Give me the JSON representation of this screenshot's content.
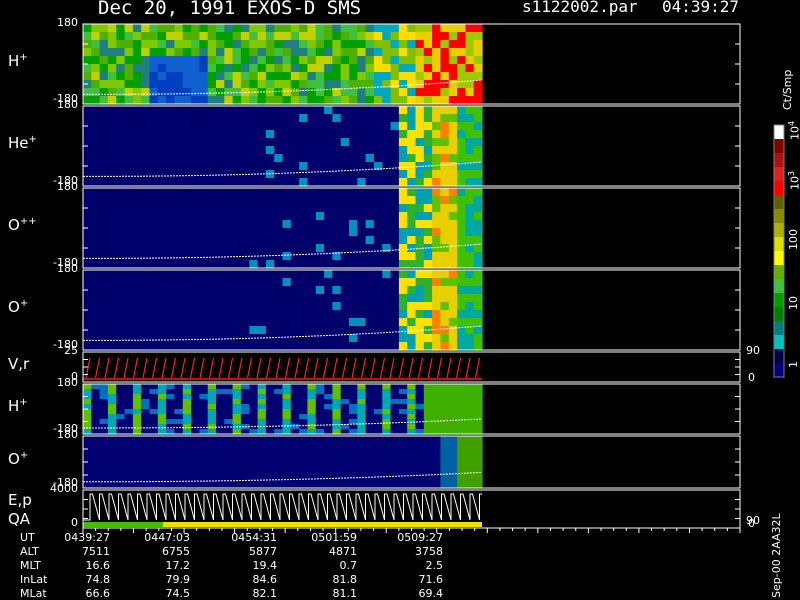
{
  "header": {
    "date_line": "Dec 20, 1991   EXOS-D SMS",
    "file": "s1122002.par",
    "time": "04:39:27"
  },
  "panels": [
    {
      "label": "H",
      "sup": "+",
      "ymax": "180",
      "ymin": "-180"
    },
    {
      "label": "He",
      "sup": "+",
      "ymax": "180",
      "ymin": "-180"
    },
    {
      "label": "O",
      "sup": "++",
      "ymax": "180",
      "ymin": "-180"
    },
    {
      "label": "O",
      "sup": "+",
      "ymax": "180",
      "ymin": "-180"
    },
    {
      "label": "V,r",
      "sup": "",
      "ymax": "25",
      "ymin": "0",
      "right_top": "90",
      "right_bottom": "0"
    },
    {
      "label": "H",
      "sup": "+",
      "ymax": "180",
      "ymin": "-180"
    },
    {
      "label": "O",
      "sup": "+",
      "ymax": "180",
      "ymin": "-180"
    },
    {
      "label": "E,p",
      "label2": "QA",
      "sup": "",
      "ymax": "4000",
      "ymin": "0",
      "right_top": "90",
      "right_bottom": "0"
    }
  ],
  "colorbar": {
    "unit": "Ct/Smp",
    "ticks": [
      "10",
      "10",
      "100",
      "10",
      "1"
    ],
    "tick_sups": [
      "4",
      "3",
      "",
      "",
      ""
    ],
    "colors": [
      "#ffffff",
      "#800000",
      "#b01010",
      "#e02020",
      "#ff0000",
      "#606000",
      "#8a8a00",
      "#b0b000",
      "#e0e000",
      "#ffff00",
      "#60b000",
      "#40c040",
      "#00a000",
      "#008000",
      "#008080",
      "#00c0c0",
      "#00004a",
      "#000080"
    ]
  },
  "footer": {
    "rows": [
      {
        "label": "UT",
        "values": [
          "0439:27",
          "0447:03",
          "0454:31",
          "0501:59",
          "0509:27"
        ]
      },
      {
        "label": "ALT",
        "values": [
          "7511",
          "6755",
          "5877",
          "4871",
          "3758"
        ]
      },
      {
        "label": "MLT",
        "values": [
          "16.6",
          "17.2",
          "19.4",
          "0.7",
          "2.5"
        ]
      },
      {
        "label": "InLat",
        "values": [
          "74.8",
          "79.9",
          "84.6",
          "81.8",
          "71.6"
        ]
      },
      {
        "label": "MLat",
        "values": [
          "66.6",
          "74.5",
          "82.1",
          "81.1",
          "69.4"
        ]
      }
    ],
    "stamp": "Sep-00  2AA32L"
  },
  "chart_data": {
    "type": "heatmap",
    "title": "Dec 20, 1991   EXOS-D SMS",
    "subtitle": "s1122002.par  04:39:27",
    "x_ticks": [
      "0439:27",
      "0447:03",
      "0454:31",
      "0501:59",
      "0509:27"
    ],
    "series": [
      {
        "name": "H+",
        "y_range": [
          -180,
          180
        ]
      },
      {
        "name": "He+",
        "y_range": [
          -180,
          180
        ]
      },
      {
        "name": "O++",
        "y_range": [
          -180,
          180
        ]
      },
      {
        "name": "O+",
        "y_range": [
          -180,
          180
        ]
      },
      {
        "name": "V,r",
        "y_range": [
          0,
          25
        ],
        "right_range": [
          0,
          90
        ]
      },
      {
        "name": "H+",
        "y_range": [
          -180,
          180
        ]
      },
      {
        "name": "O+",
        "y_range": [
          -180,
          180
        ]
      },
      {
        "name": "E,p",
        "y_range": [
          0,
          4000
        ],
        "right_range": [
          0,
          90
        ]
      }
    ],
    "colorbar": {
      "label": "Ct/Smp",
      "scale": "log",
      "range": [
        1,
        10000
      ]
    },
    "data_extent_fraction": 0.82,
    "grid": false
  }
}
